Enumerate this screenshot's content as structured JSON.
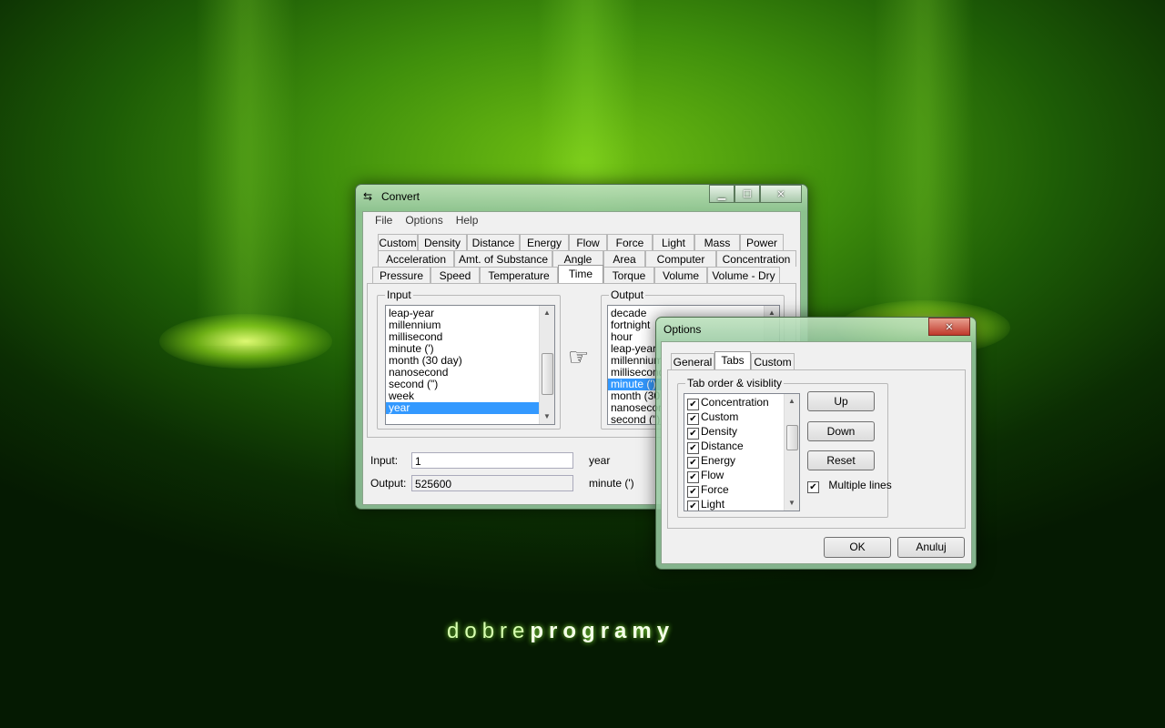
{
  "desktop": {
    "brand_light": "dobre",
    "brand_bold": "programy"
  },
  "convert": {
    "title": "Convert",
    "menu": [
      "File",
      "Options",
      "Help"
    ],
    "tabs_row1": [
      "Custom",
      "Density",
      "Distance",
      "Energy",
      "Flow",
      "Force",
      "Light",
      "Mass",
      "Power"
    ],
    "tabs_row2": [
      "Acceleration",
      "Amt. of Substance",
      "Angle",
      "Area",
      "Computer",
      "Concentration"
    ],
    "tabs_row3": [
      "Pressure",
      "Speed",
      "Temperature",
      "Time",
      "Torque",
      "Volume",
      "Volume - Dry"
    ],
    "selected_tab": "Time",
    "input_group": "Input",
    "output_group": "Output",
    "input_list": [
      "leap-year",
      "millennium",
      "millisecond",
      "minute (')",
      "month (30 day)",
      "nanosecond",
      "second (\")",
      "week",
      "year"
    ],
    "input_selected": "year",
    "output_list": [
      "decade",
      "fortnight",
      "hour",
      "leap-year",
      "millennium",
      "millisecond",
      "minute (')",
      "month (30",
      "nanosecond",
      "second (\")"
    ],
    "output_selected": "minute (')",
    "pointer_glyph": "☞",
    "input_label": "Input:",
    "input_value": "1",
    "input_unit": "year",
    "output_label": "Output:",
    "output_value": "525600",
    "output_unit": "minute (')"
  },
  "options": {
    "title": "Options",
    "tabs": [
      "General",
      "Tabs",
      "Custom"
    ],
    "selected_tab": "Tabs",
    "group_label": "Tab order & visiblity",
    "items": [
      {
        "label": "Concentration",
        "checked": true
      },
      {
        "label": "Custom",
        "checked": true
      },
      {
        "label": "Density",
        "checked": true
      },
      {
        "label": "Distance",
        "checked": true
      },
      {
        "label": "Energy",
        "checked": true
      },
      {
        "label": "Flow",
        "checked": true
      },
      {
        "label": "Force",
        "checked": true
      },
      {
        "label": "Light",
        "checked": true
      }
    ],
    "up_label": "Up",
    "down_label": "Down",
    "reset_label": "Reset",
    "multiple_lines_label": "Multiple lines",
    "multiple_lines_checked": true,
    "ok_label": "OK",
    "cancel_label": "Anuluj"
  },
  "colors": {
    "selection": "#3399ff",
    "accent_green": "#6fbf12"
  },
  "icons": {
    "close": "close-icon",
    "minimize": "minimize-icon",
    "maximize": "maximize-icon",
    "app": "convert-arrows-icon"
  }
}
